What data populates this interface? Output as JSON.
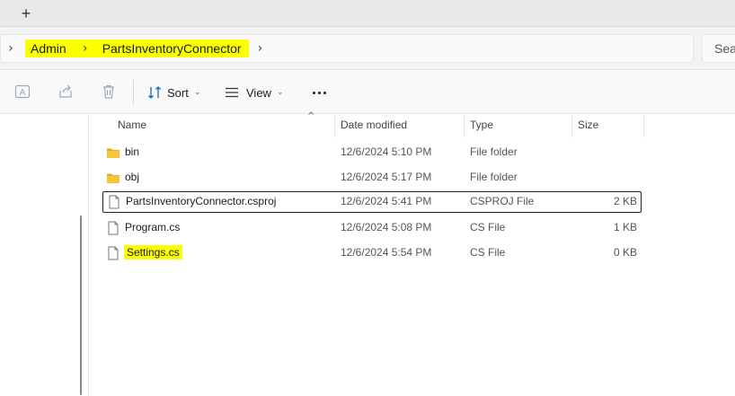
{
  "tabbar": {
    "new_tab_label": "+"
  },
  "address": {
    "crumbs": [
      "Admin",
      "PartsInventoryConnector"
    ],
    "chevron": "›",
    "search_placeholder": "Sea"
  },
  "toolbar": {
    "icons": [
      "rename-icon",
      "share-icon",
      "delete-icon"
    ],
    "sort_label": "Sort",
    "view_label": "View",
    "caret": "⌄",
    "more_label": "More options"
  },
  "columns": {
    "name": "Name",
    "date": "Date modified",
    "type": "Type",
    "size": "Size",
    "sort_indicator": "^"
  },
  "files": [
    {
      "name": "bin",
      "date": "12/6/2024 5:10 PM",
      "type": "File folder",
      "size": "",
      "icon": "folder-icon",
      "highlighted": false,
      "focused": false
    },
    {
      "name": "obj",
      "date": "12/6/2024 5:17 PM",
      "type": "File folder",
      "size": "",
      "icon": "folder-icon",
      "highlighted": false,
      "focused": false
    },
    {
      "name": "PartsInventoryConnector.csproj",
      "date": "12/6/2024 5:41 PM",
      "type": "CSPROJ File",
      "size": "2 KB",
      "icon": "file-icon",
      "highlighted": false,
      "focused": true
    },
    {
      "name": "Program.cs",
      "date": "12/6/2024 5:08 PM",
      "type": "CS File",
      "size": "1 KB",
      "icon": "file-icon",
      "highlighted": false,
      "focused": false
    },
    {
      "name": "Settings.cs",
      "date": "12/6/2024 5:54 PM",
      "type": "CS File",
      "size": "0 KB",
      "icon": "file-icon",
      "highlighted": true,
      "focused": false
    }
  ],
  "colors": {
    "highlight": "#fcff00",
    "folder": "#f8c53a",
    "accent": "#0067c0"
  }
}
